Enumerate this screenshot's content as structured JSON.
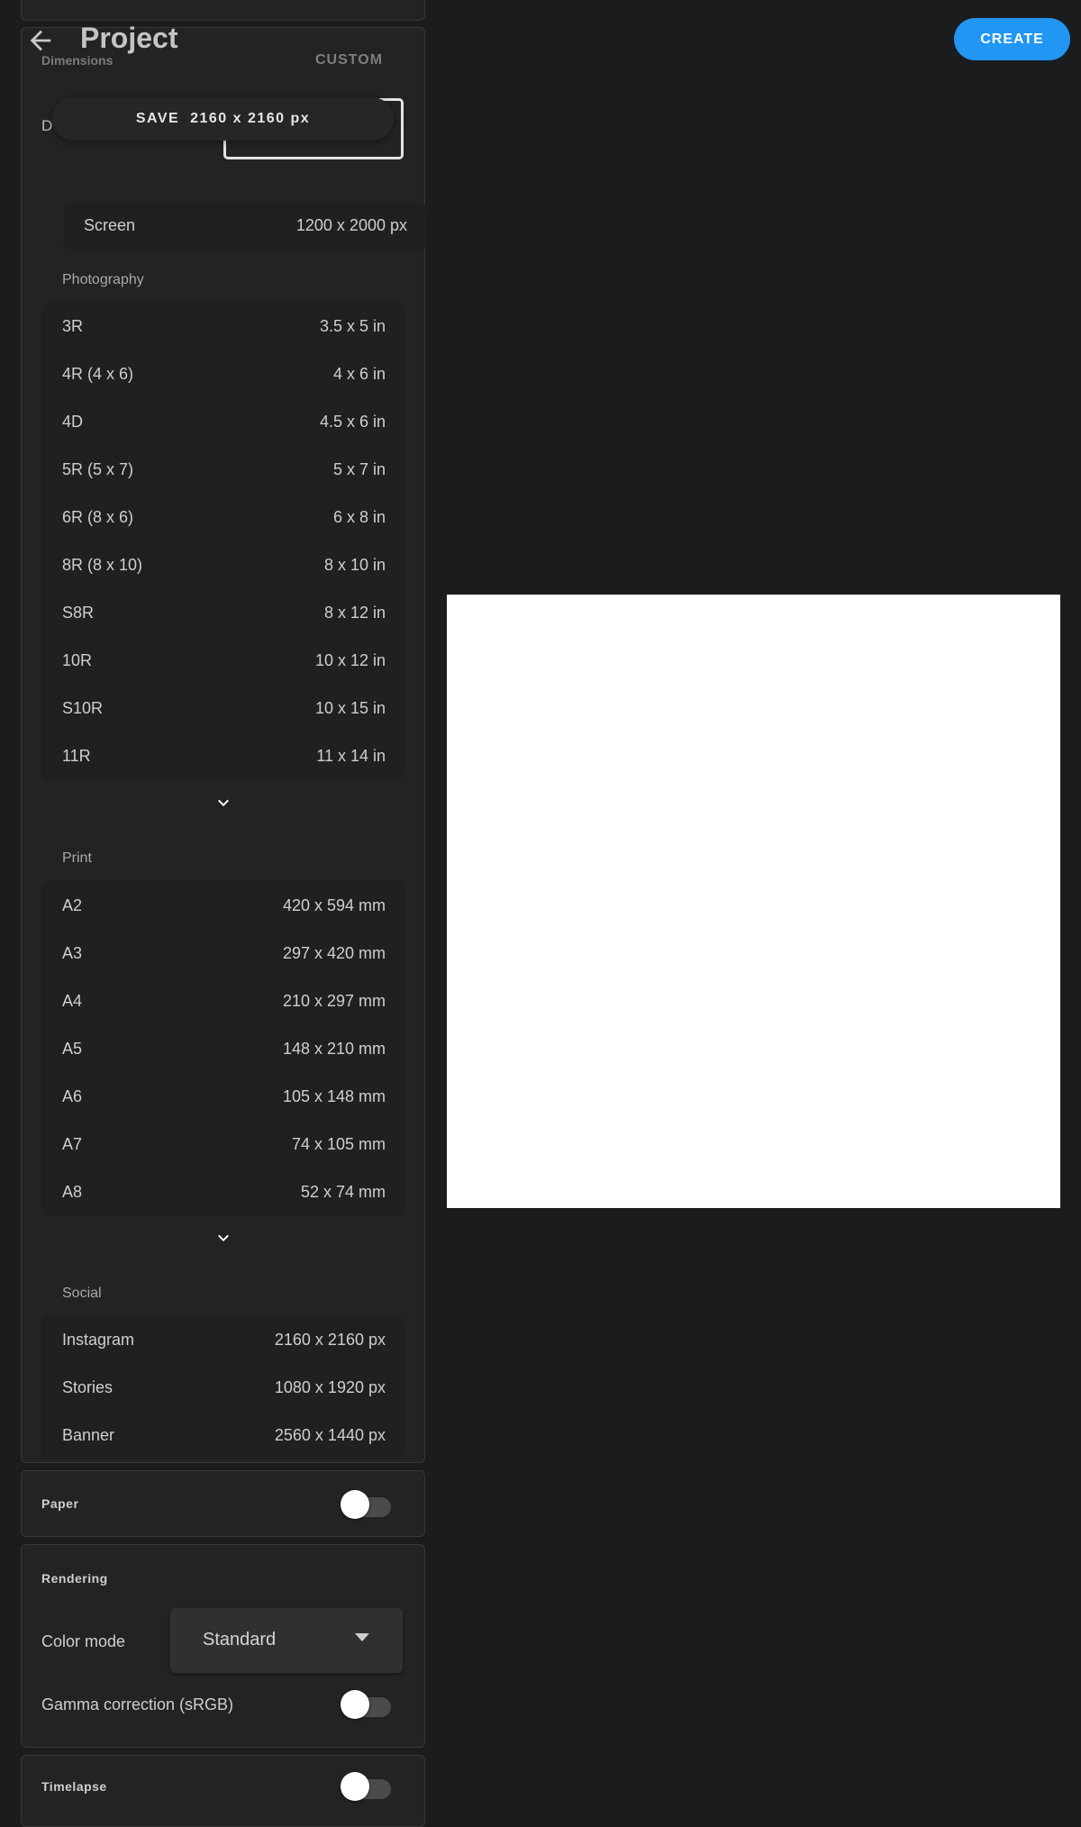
{
  "header": {
    "title": "Project",
    "create_label": "CREATE",
    "back_icon": "arrow-left-icon"
  },
  "dimensions": {
    "section_label": "Dimensions",
    "custom_label": "CUSTOM",
    "field_label_partial": "D",
    "save_chip": "SAVE  2160 x 2160 px",
    "screen": {
      "name": "Screen",
      "size": "1200 x 2000 px"
    },
    "groups": [
      {
        "label": "Photography",
        "items": [
          {
            "name": "3R",
            "size": "3.5 x 5 in"
          },
          {
            "name": "4R (4 x 6)",
            "size": "4 x 6 in"
          },
          {
            "name": "4D",
            "size": "4.5 x 6 in"
          },
          {
            "name": "5R (5 x 7)",
            "size": "5 x 7 in"
          },
          {
            "name": "6R (8 x 6)",
            "size": "6 x 8 in"
          },
          {
            "name": "8R (8 x 10)",
            "size": "8 x 10 in"
          },
          {
            "name": "S8R",
            "size": "8 x 12 in"
          },
          {
            "name": "10R",
            "size": "10 x 12 in"
          },
          {
            "name": "S10R",
            "size": "10 x 15 in"
          },
          {
            "name": "11R",
            "size": "11 x 14 in"
          }
        ]
      },
      {
        "label": "Print",
        "items": [
          {
            "name": "A2",
            "size": "420 x 594 mm"
          },
          {
            "name": "A3",
            "size": "297 x 420 mm"
          },
          {
            "name": "A4",
            "size": "210 x 297 mm"
          },
          {
            "name": "A5",
            "size": "148 x 210 mm"
          },
          {
            "name": "A6",
            "size": "105 x 148 mm"
          },
          {
            "name": "A7",
            "size": "74 x 105 mm"
          },
          {
            "name": "A8",
            "size": "52 x 74 mm"
          }
        ]
      },
      {
        "label": "Social",
        "items": [
          {
            "name": "Instagram",
            "size": "2160 x 2160 px"
          },
          {
            "name": "Stories",
            "size": "1080 x 1920 px"
          },
          {
            "name": "Banner",
            "size": "2560 x 1440 px"
          }
        ]
      }
    ]
  },
  "paper": {
    "label": "Paper",
    "enabled": false
  },
  "rendering": {
    "label": "Rendering",
    "color_mode_label": "Color mode",
    "color_mode_value": "Standard",
    "gamma_label": "Gamma correction (sRGB)",
    "gamma_enabled": false
  },
  "timelapse": {
    "label": "Timelapse",
    "enabled": false
  },
  "colors": {
    "accent": "#2196f3",
    "canvas": "#ffffff",
    "background": "#1b1c1e"
  }
}
